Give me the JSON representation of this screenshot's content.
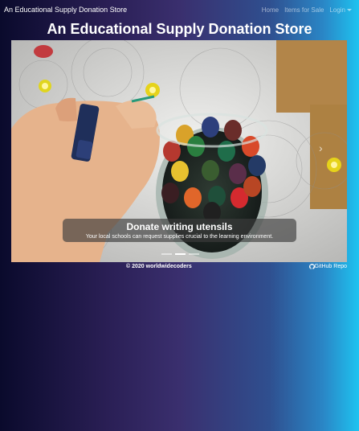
{
  "navbar": {
    "brand": "An Educational Supply Donation Store",
    "links": [
      "Home",
      "Items for Sale",
      "Login"
    ]
  },
  "page_title": "An Educational Supply Donation Store",
  "carousel": {
    "caption_title": "Donate writing utensils",
    "caption_text": "Your local schools can request supplies crucial to the learning environment.",
    "slide_count": 3,
    "active_slide": 2
  },
  "footer": {
    "copyright": "© 2020 worldwidecoders",
    "repo_link": "GitHub Repo",
    "repo_icon": "github-icon"
  }
}
